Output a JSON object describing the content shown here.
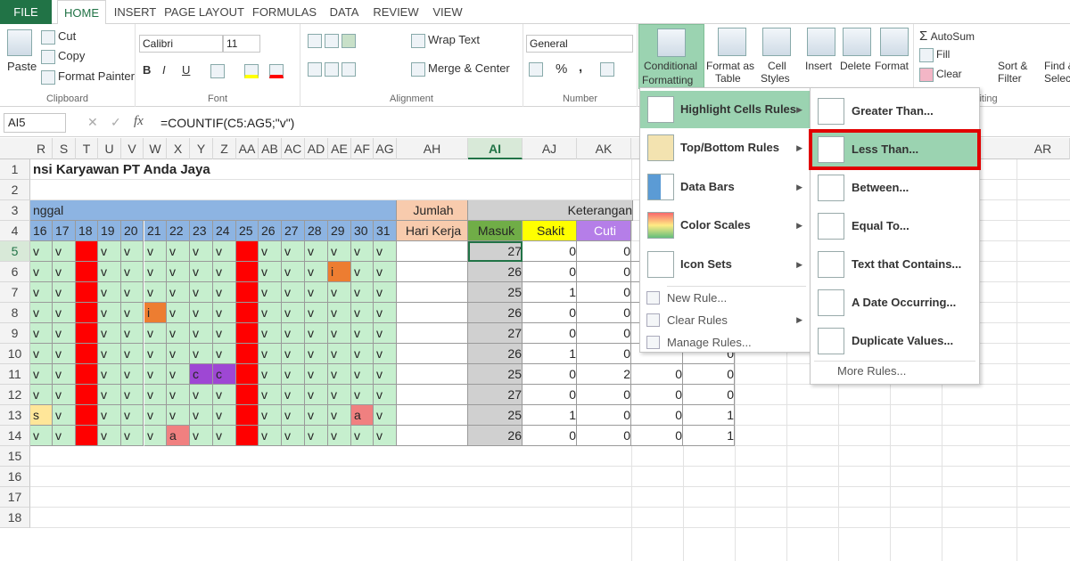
{
  "tabs": [
    "FILE",
    "HOME",
    "INSERT",
    "PAGE LAYOUT",
    "FORMULAS",
    "DATA",
    "REVIEW",
    "VIEW"
  ],
  "ribbon": {
    "clipboard": {
      "paste": "Paste",
      "cut": "Cut",
      "copy": "Copy",
      "format_painter": "Format Painter",
      "label": "Clipboard"
    },
    "font": {
      "name": "Calibri",
      "size": "11",
      "bold": "B",
      "italic": "I",
      "underline": "U",
      "label": "Font"
    },
    "alignment": {
      "wrap": "Wrap Text",
      "merge": "Merge & Center",
      "label": "Alignment"
    },
    "number": {
      "format": "General",
      "percent": "%",
      "comma": ",",
      "label": "Number"
    },
    "styles": {
      "cond": "Conditional",
      "cond2": "Formatting",
      "fmt_table": "Format as",
      "fmt_table2": "Table",
      "cell_styles": "Cell",
      "cell_styles2": "Styles"
    },
    "cells": {
      "insert": "Insert",
      "delete": "Delete",
      "format": "Format"
    },
    "editing": {
      "autosum": "AutoSum",
      "fill": "Fill",
      "clear": "Clear",
      "sort": "Sort &",
      "sort2": "Filter",
      "find": "Find &",
      "find2": "Select",
      "label": "Editing"
    }
  },
  "formula_bar": {
    "name_box": "AI5",
    "fx": "fx",
    "formula": "=COUNTIF(C5:AG5;\"v\")"
  },
  "columns": [
    "R",
    "S",
    "T",
    "U",
    "V",
    "W",
    "X",
    "Y",
    "Z",
    "AA",
    "AB",
    "AC",
    "AD",
    "AE",
    "AF",
    "AG",
    "AH",
    "AI",
    "AJ",
    "AK",
    "AR"
  ],
  "rows": [
    "1",
    "2",
    "3",
    "4",
    "5",
    "6",
    "7",
    "8",
    "9",
    "10",
    "11",
    "12",
    "13",
    "14",
    "15",
    "16",
    "17",
    "18"
  ],
  "sheet": {
    "title": "nsi Karyawan PT Anda Jaya",
    "tanggal": "nggal",
    "jumlah": "Jumlah",
    "hari_kerja": "Hari Kerja",
    "keterangan": "Keterangan",
    "masuk": "Masuk",
    "sakit": "Sakit",
    "cuti": "Cuti",
    "days": [
      "16",
      "17",
      "18",
      "19",
      "20",
      "21",
      "22",
      "23",
      "24",
      "25",
      "26",
      "27",
      "28",
      "29",
      "30",
      "31"
    ],
    "grid": [
      [
        "v",
        "v",
        "",
        "v",
        "v",
        "v",
        "v",
        "v",
        "v",
        "",
        "v",
        "v",
        "v",
        "v",
        "v",
        "v"
      ],
      [
        "v",
        "v",
        "",
        "v",
        "v",
        "v",
        "v",
        "v",
        "v",
        "",
        "v",
        "v",
        "v",
        "i",
        "v",
        "v"
      ],
      [
        "v",
        "v",
        "",
        "v",
        "v",
        "v",
        "v",
        "v",
        "v",
        "",
        "v",
        "v",
        "v",
        "v",
        "v",
        "v"
      ],
      [
        "v",
        "v",
        "",
        "v",
        "v",
        "i",
        "v",
        "v",
        "v",
        "",
        "v",
        "v",
        "v",
        "v",
        "v",
        "v"
      ],
      [
        "v",
        "v",
        "",
        "v",
        "v",
        "v",
        "v",
        "v",
        "v",
        "",
        "v",
        "v",
        "v",
        "v",
        "v",
        "v"
      ],
      [
        "v",
        "v",
        "",
        "v",
        "v",
        "v",
        "v",
        "v",
        "v",
        "",
        "v",
        "v",
        "v",
        "v",
        "v",
        "v"
      ],
      [
        "v",
        "v",
        "",
        "v",
        "v",
        "v",
        "v",
        "c",
        "c",
        "",
        "v",
        "v",
        "v",
        "v",
        "v",
        "v"
      ],
      [
        "v",
        "v",
        "",
        "v",
        "v",
        "v",
        "v",
        "v",
        "v",
        "",
        "v",
        "v",
        "v",
        "v",
        "v",
        "v"
      ],
      [
        "s",
        "v",
        "",
        "v",
        "v",
        "v",
        "v",
        "v",
        "v",
        "",
        "v",
        "v",
        "v",
        "v",
        "a",
        "v"
      ],
      [
        "v",
        "v",
        "",
        "v",
        "v",
        "v",
        "a",
        "v",
        "v",
        "",
        "v",
        "v",
        "v",
        "v",
        "v",
        "v"
      ]
    ],
    "masuk_vals": [
      "27",
      "26",
      "25",
      "26",
      "27",
      "26",
      "25",
      "27",
      "25",
      "26"
    ],
    "sakit_vals": [
      "0",
      "0",
      "1",
      "0",
      "0",
      "1",
      "0",
      "0",
      "1",
      "0"
    ],
    "cuti_vals": [
      "0",
      "0",
      "0",
      "0",
      "0",
      "0",
      "2",
      "0",
      "0",
      "0"
    ],
    "col_ak": [
      "",
      "",
      "",
      "",
      "",
      "",
      "0",
      "0",
      "0",
      "0"
    ],
    "col_al": [
      "",
      "",
      "",
      "",
      "",
      "0",
      "0",
      "0",
      "1",
      "1"
    ]
  },
  "cf_menu": {
    "items": [
      "Highlight Cells Rules",
      "Top/Bottom Rules",
      "Data Bars",
      "Color Scales",
      "Icon Sets"
    ],
    "small": [
      "New Rule...",
      "Clear Rules",
      "Manage Rules..."
    ]
  },
  "submenu": {
    "items": [
      "Greater Than...",
      "Less Than...",
      "Between...",
      "Equal To...",
      "Text that Contains...",
      "A Date Occurring...",
      "Duplicate Values..."
    ],
    "more": "More Rules..."
  },
  "colors": {
    "green": "#c6efce",
    "red": "#ff0000",
    "orange": "#ed7d31",
    "purple": "#9e47d4",
    "yellow": "#ffe699",
    "pink": "#f08080",
    "blue_hdr": "#8db4e2",
    "peach": "#f8cbad",
    "grey": "#d0d0d0",
    "masuk": "#70ad47",
    "sakit": "#ffff00",
    "cuti": "#b57ee8",
    "accent": "#217346",
    "highlight": "#9bd3b1"
  }
}
